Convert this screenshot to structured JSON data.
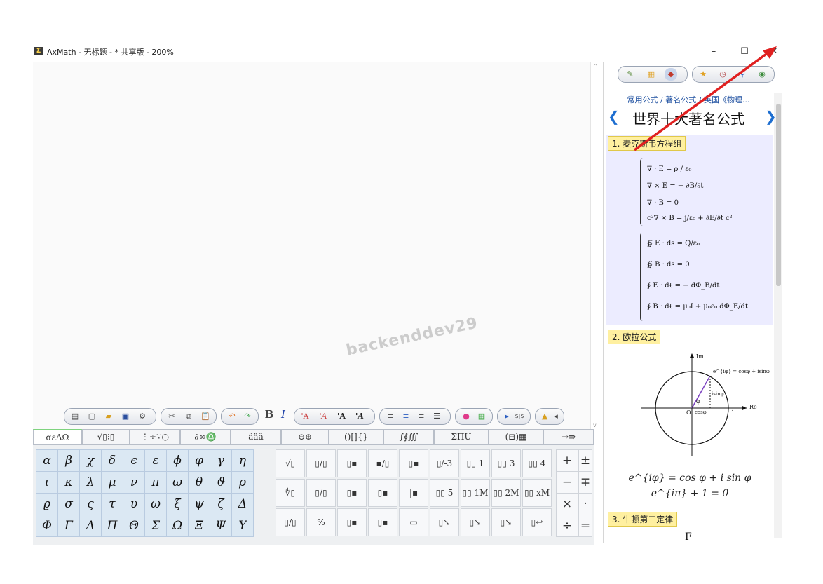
{
  "window": {
    "title": "AxMath - 无标题 - * 共享版 - 200%",
    "minimize": "–",
    "maximize": "☐",
    "close": "✕"
  },
  "watermark": "backenddev29",
  "toolbar": {
    "bold": "B",
    "italic": "I",
    "font_a1": "'A",
    "font_a2": "'A",
    "font_a3": "'A",
    "font_a4": "'A"
  },
  "tabs": [
    "αεΔΩ",
    "√▯⁝▯",
    "⋮÷∵○",
    "∂∞♎",
    "âäã",
    "⊖⊕",
    "()[]{}",
    "∫∮∭",
    "ΣΠU",
    "(⊟)▦",
    "→⇛"
  ],
  "greek": [
    [
      "α",
      "β",
      "χ",
      "δ",
      "ϵ",
      "ε",
      "ϕ",
      "φ",
      "γ",
      "η"
    ],
    [
      "ι",
      "κ",
      "λ",
      "μ",
      "ν",
      "π",
      "ϖ",
      "θ",
      "ϑ",
      "ρ"
    ],
    [
      "ϱ",
      "σ",
      "ς",
      "τ",
      "υ",
      "ω",
      "ξ",
      "ψ",
      "ζ",
      "Δ"
    ],
    [
      "Φ",
      "Γ",
      "Λ",
      "Π",
      "Θ",
      "Σ",
      "Ω",
      "Ξ",
      "Ψ",
      "Υ"
    ]
  ],
  "templates": [
    [
      "√▯",
      "▯/▯",
      "▯▪",
      "▪/▯",
      "▯▪",
      "▯/-3",
      "▯▯ 1",
      "▯▯ 3",
      "▯▯ 4"
    ],
    [
      "∜▯",
      "▯/▯",
      "▯▪",
      "▯▪",
      "|▪",
      "▯▯ 5",
      "▯▯ 1M",
      "▯▯ 2M",
      "▯▯ xM"
    ],
    [
      "▯/▯",
      "%",
      "▯▪",
      "▯▪",
      "▭",
      "▯↘",
      "▯↘",
      "▯↘",
      "▯↩"
    ]
  ],
  "operators": [
    "+",
    "−",
    "×",
    "÷"
  ],
  "operators2": [
    "±",
    "∓",
    "·",
    "="
  ],
  "panel": {
    "breadcrumb": "常用公式 / 著名公式 / 英国《物理...",
    "title": "世界十大著名公式",
    "prev": "❮",
    "next": "❯",
    "sections": [
      {
        "label": "1. 麦克斯韦方程组"
      },
      {
        "label": "2. 欧拉公式"
      },
      {
        "label": "3. 牛顿第二定律"
      }
    ],
    "maxwell_diff": [
      "∇ · E = ρ / ε₀",
      "∇ × E = − ∂B/∂t",
      "∇ · B = 0",
      "c²∇ × B = j/ε₀ + ∂E/∂t c²"
    ],
    "maxwell_int": [
      "∯ E · ds = Q/ε₀",
      "∯ B · ds = 0",
      "∮ E · dℓ = − dΦ_B/dt",
      "∮ B · dℓ = μ₀I + μ₀ε₀ dΦ_E/dt"
    ],
    "euler_diagram": {
      "im": "Im",
      "re": "Re",
      "origin": "O",
      "one": "1",
      "phi": "φ",
      "cos": "cosφ",
      "sin": "isinφ",
      "eq": "e^{iφ} = cosφ + isinφ"
    },
    "euler1": "e^{iφ} = cos φ + i sin φ",
    "euler2": "e^{iπ} + 1 = 0",
    "newton_partial": "F"
  }
}
